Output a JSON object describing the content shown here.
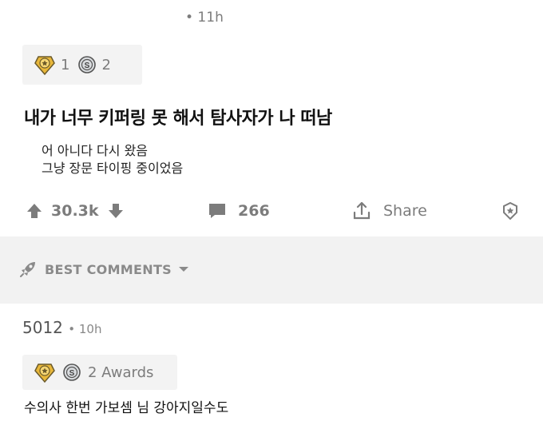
{
  "post": {
    "time": "• 11h",
    "awards": [
      {
        "icon": "gold-award-icon",
        "count": "1"
      },
      {
        "icon": "silver-award-icon",
        "count": "2"
      }
    ],
    "title": "내가 너무 키퍼링 못 해서 탐사자가 나 떠남",
    "body_line1": "어 아니다 다시 왔음",
    "body_line2": "그냥 장문 타이핑 중이었음",
    "votes": "30.3k",
    "comments": "266",
    "share_label": "Share"
  },
  "sort": {
    "label": "BEST COMMENTS"
  },
  "comment": {
    "score": "5012",
    "time": "• 10h",
    "awards_label": "2 Awards",
    "text": "수의사 한번 가보셈 님 강아지일수도"
  },
  "colors": {
    "gold": "#e8b73a",
    "silver": "#9aa0a6",
    "muted": "#7c7c7c",
    "band": "#f2f2f2"
  }
}
